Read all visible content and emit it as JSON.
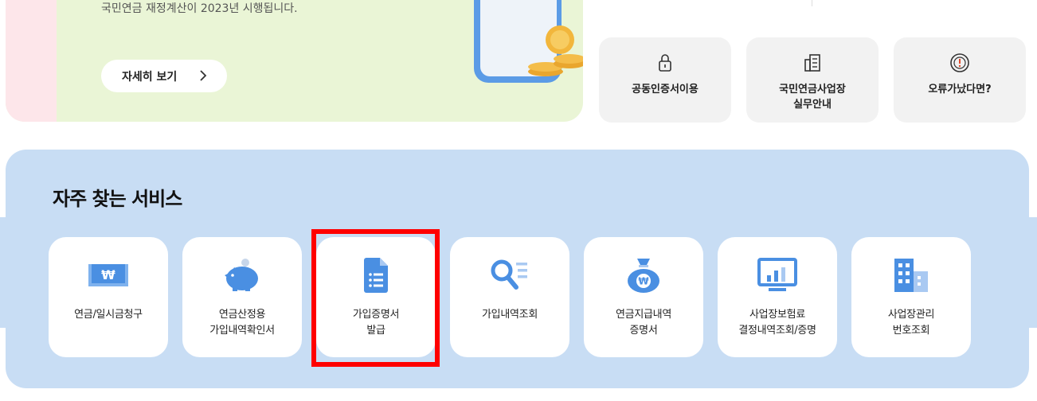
{
  "banner": {
    "text": "국민연금 재정계산이 2023년 시행됩니다.",
    "detail_label": "자세히 보기"
  },
  "quick_links": [
    {
      "label": "공동인증서이용",
      "icon": "lock-icon"
    },
    {
      "label": "국민연금사업장\n실무안내",
      "icon": "document-icon"
    },
    {
      "label": "오류가났다면?",
      "icon": "alert-icon"
    }
  ],
  "services": {
    "title": "자주 찾는 서비스",
    "items": [
      {
        "label": "연금/일시금청구",
        "icon": "won-card-icon"
      },
      {
        "label": "연금산정용\n가입내역확인서",
        "icon": "piggy-bank-icon"
      },
      {
        "label": "가입증명서\n발급",
        "icon": "certificate-document-icon"
      },
      {
        "label": "가입내역조회",
        "icon": "search-list-icon"
      },
      {
        "label": "연금지급내역\n증명서",
        "icon": "money-bag-icon"
      },
      {
        "label": "사업장보험료\n결정내역조회/증명",
        "icon": "chart-monitor-icon"
      },
      {
        "label": "사업장관리\n번호조회",
        "icon": "building-icon"
      }
    ]
  },
  "colors": {
    "accent_blue": "#4a8fe2",
    "services_bg": "#c8ddf4",
    "highlight": "#ff0000",
    "banner_bg": "#eaf5d6"
  }
}
